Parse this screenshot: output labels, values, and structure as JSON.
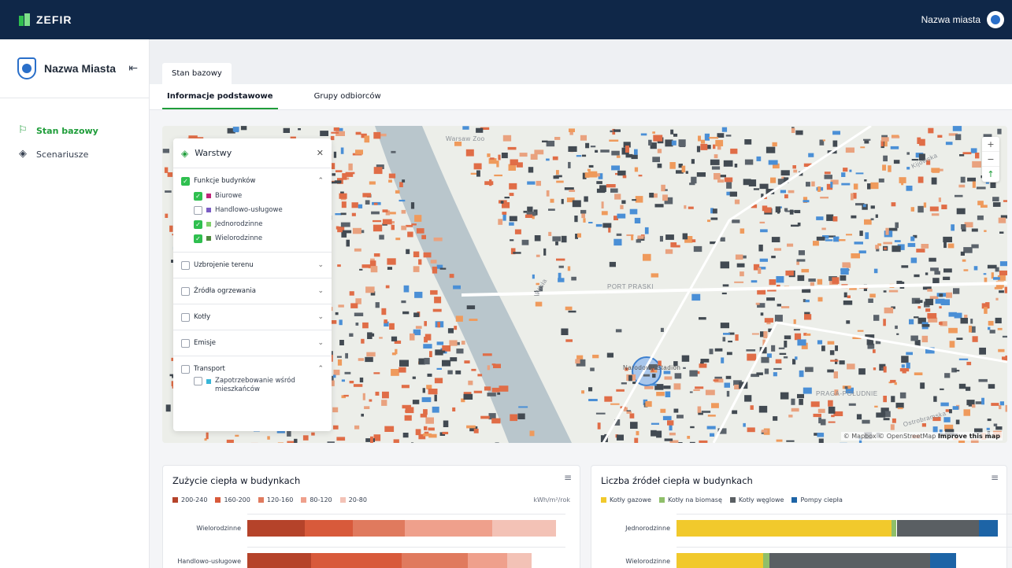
{
  "app": {
    "name": "ZEFIR",
    "user_label": "Nazwa miasta"
  },
  "sidebar": {
    "city": "Nazwa Miasta",
    "items": [
      {
        "label": "Stan bazowy",
        "icon": "flag-icon",
        "active": true
      },
      {
        "label": "Scenariusze",
        "icon": "layers-icon",
        "active": false
      }
    ]
  },
  "tabs": {
    "main": "Stan bazowy",
    "sub": [
      "Informacje podstawowe",
      "Grupy odbiorców"
    ]
  },
  "layers_panel": {
    "title": "Warstwy",
    "groups": [
      {
        "label": "Funkcje budynków",
        "checked": true,
        "expanded": true,
        "items": [
          {
            "label": "Biurowe",
            "checked": true,
            "color": "#c0247a"
          },
          {
            "label": "Handlowo-usługowe",
            "checked": false,
            "color": "#7b5cc4"
          },
          {
            "label": "Jednorodzinne",
            "checked": true,
            "color": "#7fcf6b"
          },
          {
            "label": "Wielorodzinne",
            "checked": true,
            "color": "#4e8b3e"
          }
        ]
      },
      {
        "label": "Uzbrojenie terenu",
        "checked": false,
        "expanded": false
      },
      {
        "label": "Źródła ogrzewania",
        "checked": false,
        "expanded": false
      },
      {
        "label": "Kotły",
        "checked": false,
        "expanded": false
      },
      {
        "label": "Emisje",
        "checked": false,
        "expanded": false
      },
      {
        "label": "Transport",
        "checked": false,
        "expanded": true,
        "items": [
          {
            "label": "Zapotrzebowanie wśród mieszkańców",
            "checked": false,
            "color": "#38b6d8"
          }
        ]
      }
    ]
  },
  "map": {
    "attribution": "© Mapbox © OpenStreetMap",
    "improve": "Improve this map",
    "labels": [
      "Wisła",
      "PORT PRASKI",
      "Narodowy Stadion",
      "PRAGA-POŁUDNIE",
      "Warsaw Zoo",
      "Kijowska",
      "Ostrobramska"
    ]
  },
  "chart1": {
    "title": "Zużycie ciepła w budynkach",
    "unit": "kWh/m²/rok",
    "legend": [
      {
        "label": "200-240",
        "color": "#b5432a"
      },
      {
        "label": "160-200",
        "color": "#d85a3b"
      },
      {
        "label": "120-160",
        "color": "#e07a5e"
      },
      {
        "label": "80-120",
        "color": "#efa08c"
      },
      {
        "label": "20-80",
        "color": "#f3c2b6"
      }
    ]
  },
  "chart2": {
    "title": "Liczba źródeł ciepła w budynkach",
    "legend": [
      {
        "label": "Kotły gazowe",
        "color": "#f1c92c"
      },
      {
        "label": "Kotły na biomasę",
        "color": "#8fbf6a"
      },
      {
        "label": "Kotły węglowe",
        "color": "#5a5f63"
      },
      {
        "label": "Pompy ciepła",
        "color": "#1d64a6"
      }
    ]
  },
  "chart_data": [
    {
      "type": "bar",
      "title": "Zużycie ciepła w budynkach",
      "categories": [
        "Wielorodzinne",
        "Handlowo-usługowe"
      ],
      "series": [
        {
          "name": "200-240",
          "values": [
            19,
            21
          ]
        },
        {
          "name": "160-200",
          "values": [
            16,
            30
          ]
        },
        {
          "name": "120-160",
          "values": [
            17,
            22
          ]
        },
        {
          "name": "80-120",
          "values": [
            29,
            13
          ]
        },
        {
          "name": "20-80",
          "values": [
            21,
            8
          ]
        }
      ],
      "ylabel": "kWh/m²/rok"
    },
    {
      "type": "bar",
      "title": "Liczba źródeł ciepła w budynkach",
      "categories": [
        "Jednorodzinne",
        "Wielorodzinne"
      ],
      "series": [
        {
          "name": "Kotły gazowe",
          "values": [
            67,
            27
          ]
        },
        {
          "name": "Kotły na biomasę",
          "values": [
            1.5,
            2
          ]
        },
        {
          "name": "Kotły węglowe",
          "values": [
            25.5,
            50
          ]
        },
        {
          "name": "Pompy ciepła",
          "values": [
            6,
            8
          ]
        }
      ]
    }
  ]
}
